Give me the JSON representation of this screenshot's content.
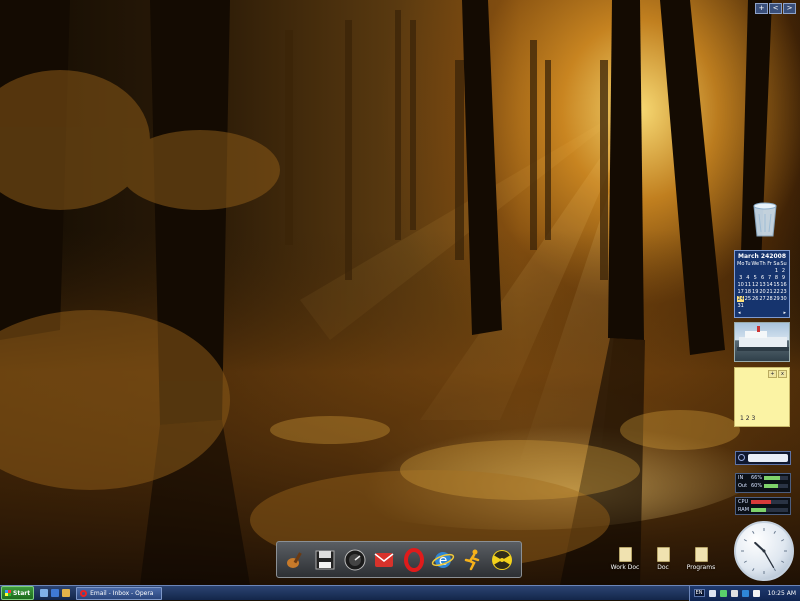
{
  "desktop": {
    "wallpaper": "forest-sunset",
    "top_buttons": [
      "+",
      "<",
      ">"
    ]
  },
  "sidebar": {
    "recycle_bin": {
      "icon": "recycle-bin-icon"
    },
    "calendar": {
      "month": "March 24",
      "year": "2008",
      "weekdays": [
        "Mo",
        "Tu",
        "We",
        "Th",
        "Fr",
        "Sa",
        "Su"
      ],
      "days": [
        "",
        "",
        "",
        "",
        "",
        "1",
        "2",
        "3",
        "4",
        "5",
        "6",
        "7",
        "8",
        "9",
        "10",
        "11",
        "12",
        "13",
        "14",
        "15",
        "16",
        "17",
        "18",
        "19",
        "20",
        "21",
        "22",
        "23",
        "24",
        "25",
        "26",
        "27",
        "28",
        "29",
        "30",
        "31",
        "",
        "",
        "",
        "",
        "",
        ""
      ],
      "today": "24"
    },
    "notes": {
      "text": "1  2  3",
      "buttons": [
        "+",
        "x"
      ]
    },
    "network_meter": {
      "rows": [
        {
          "label": "IN",
          "value": "66%",
          "level": 0.66,
          "color": "#7fd36b"
        },
        {
          "label": "Out",
          "value": "60%",
          "level": 0.6,
          "color": "#7fd36b"
        }
      ]
    },
    "system_meter": {
      "rows": [
        {
          "label": "CPU",
          "level": 0.55,
          "color": "#d83a3a"
        },
        {
          "label": "RAM",
          "level": 0.4,
          "color": "#7fd36b"
        }
      ]
    },
    "clock": {
      "hour": 10,
      "minute": 25
    }
  },
  "desktop_icons": [
    {
      "label": "Work Doc",
      "icon": "folder-icon"
    },
    {
      "label": "Doc",
      "icon": "folder-icon"
    },
    {
      "label": "Programs",
      "icon": "folder-icon"
    }
  ],
  "dock": {
    "items": [
      {
        "name": "guitar",
        "icon": "guitar-icon"
      },
      {
        "name": "floppy",
        "icon": "save-disk-icon"
      },
      {
        "name": "dial",
        "icon": "dial-icon"
      },
      {
        "name": "mail",
        "icon": "mail-icon"
      },
      {
        "name": "opera",
        "icon": "opera-icon"
      },
      {
        "name": "ie",
        "icon": "internet-explorer-icon"
      },
      {
        "name": "runner",
        "icon": "runner-icon"
      },
      {
        "name": "radiation",
        "icon": "radiation-icon"
      }
    ]
  },
  "taskbar": {
    "start_label": "Start",
    "task_email": "Email - Inbox - Opera",
    "language": "EN",
    "time": "10:25 AM"
  },
  "colors": {
    "taskbar_top": "#2c4472",
    "calendar_bg": "#16346e",
    "notes_bg": "#fbf3a4"
  }
}
